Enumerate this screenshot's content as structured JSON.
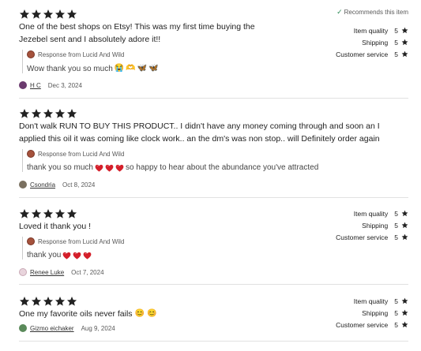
{
  "reviews": [
    {
      "stars": 5,
      "recommend": "Recommends this item",
      "text": "One of the best shops on Etsy! This was my first time buying the Jezebel sent and I absolutely adore it!!",
      "response_from": "Response from Lucid And Wild",
      "response_text": "Wow thank you so much",
      "response_emojis": [
        "😭",
        "🫶",
        "🦋",
        "🦋"
      ],
      "user": "H C",
      "date": "Dec 3, 2024",
      "ratings": [
        {
          "label": "Item quality",
          "value": "5"
        },
        {
          "label": "Shipping",
          "value": "5"
        },
        {
          "label": "Customer service",
          "value": "5"
        }
      ]
    },
    {
      "stars": 5,
      "text": "Don't walk RUN TO BUY THIS PRODUCT.. I didn't have any money coming through and soon an I applied this oil it was coming like clock work.. an the dm's was non stop.. will Definitely order again",
      "response_from": "Response from Lucid And Wild",
      "response_text_before": "thank you so much",
      "response_text_after": "so happy to hear about the abundance you've attracted",
      "user": "Csondria",
      "date": "Oct 8, 2024"
    },
    {
      "stars": 5,
      "text": "Loved it thank you !",
      "response_from": "Response from Lucid And Wild",
      "response_text": "thank you",
      "user": "Renee Luke",
      "date": "Oct 7, 2024",
      "ratings": [
        {
          "label": "Item quality",
          "value": "5"
        },
        {
          "label": "Shipping",
          "value": "5"
        },
        {
          "label": "Customer service",
          "value": "5"
        }
      ]
    },
    {
      "stars": 5,
      "text": "One my favorite oils never fails",
      "text_emojis": [
        "😊",
        "😊"
      ],
      "user": "Gizmo eichaker",
      "date": "Aug 9, 2024",
      "ratings": [
        {
          "label": "Item quality",
          "value": "5"
        },
        {
          "label": "Shipping",
          "value": "5"
        },
        {
          "label": "Customer service",
          "value": "5"
        }
      ]
    }
  ],
  "colors": {
    "star": "#222222",
    "check": "#2e8b57",
    "heart": "#d41f2a"
  },
  "icons": {
    "star": "star-icon",
    "check": "check-icon",
    "heart": "heart-icon"
  }
}
